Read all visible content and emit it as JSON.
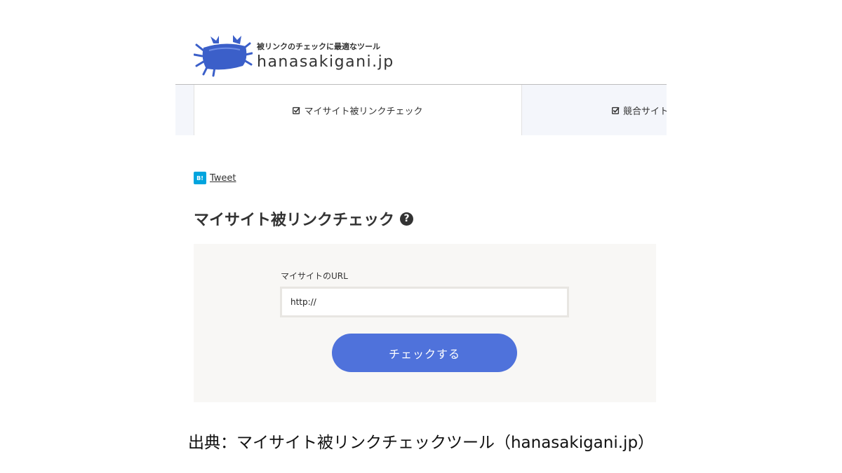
{
  "header": {
    "tagline": "被リンクのチェックに最適なツール",
    "site_name": "hanasakigani.jp"
  },
  "tabs": [
    {
      "label": "マイサイト被リンクチェック",
      "active": true
    },
    {
      "label": "競合サイト",
      "active": false
    }
  ],
  "share": {
    "hatena_label": "B!",
    "tweet_label": "Tweet"
  },
  "main": {
    "heading": "マイサイト被リンクチェック",
    "help_glyph": "?"
  },
  "form": {
    "url_label": "マイサイトのURL",
    "url_value": "http://",
    "submit_label": "チェックする"
  },
  "caption": "出典：マイサイト被リンクチェックツール（hanasakigani.jp）",
  "colors": {
    "accent_button": "#4f72db",
    "logo_blue": "#3b5fc9",
    "hatena_blue": "#00a4de",
    "panel_bg": "#f8f7f5",
    "tab_bar_bg": "#f4f6fb"
  },
  "icons": {
    "logo": "crab-logo-icon",
    "tab_check": "checkbox-checked-icon",
    "hatena": "hatena-bookmark-icon",
    "help": "question-circle-icon"
  }
}
